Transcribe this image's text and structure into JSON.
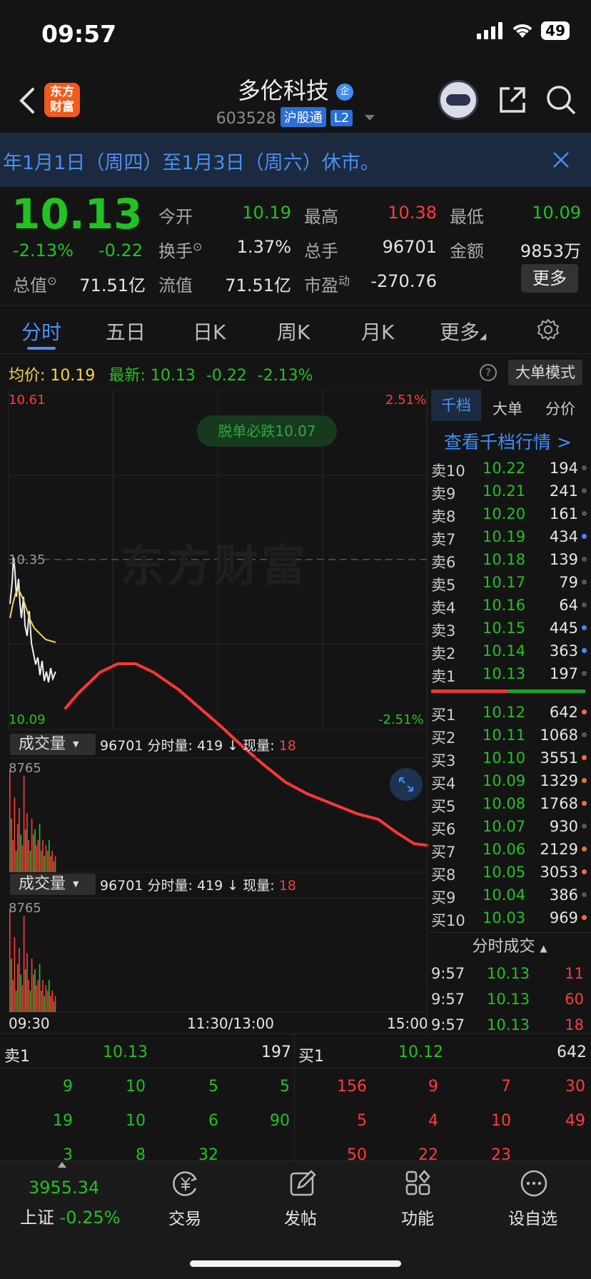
{
  "status": {
    "time": "09:57",
    "battery": "49"
  },
  "header": {
    "back_icon": "chevron-left-icon",
    "logo_text": "东方财富",
    "title": "多伦科技",
    "title_badge": "企",
    "code": "603528",
    "tag1": "沪股通",
    "tag2": "L2"
  },
  "notice": {
    "text": "年1月1日（周四）至1月3日（周六）休市。"
  },
  "quote": {
    "price": "10.13",
    "pct": "-2.13%",
    "change": "-0.22",
    "open_label": "今开",
    "open": "10.19",
    "high_label": "最高",
    "high": "10.38",
    "low_label": "最低",
    "low": "10.09",
    "turnover_label": "换手",
    "turnover": "1.37%",
    "vol_label": "总手",
    "vol": "96701",
    "amount_label": "金额",
    "amount": "9853万",
    "mktcap_label": "总值",
    "mktcap": "71.51亿",
    "float_label": "流值",
    "float": "71.51亿",
    "pe_label": "市盈",
    "pe_sup": "动",
    "pe": "-270.76",
    "more_label": "更多"
  },
  "tabs": [
    "分时",
    "五日",
    "日K",
    "周K",
    "月K",
    "更多"
  ],
  "avg_bar": {
    "avg_label": "均价:",
    "avg": "10.19",
    "latest_label": "最新:",
    "latest": "10.13",
    "change": "-0.22",
    "pct": "-2.13%",
    "mode_label": "大单模式"
  },
  "chart": {
    "top_price": "10.61",
    "top_pct": "2.51%",
    "mid_price": "10.35",
    "bottom_price": "10.09",
    "bottom_pct": "-2.51%",
    "watermark": "东方财富",
    "alert": "脱单必跌10.07",
    "vol_label": "成交量",
    "vol_total": "96701",
    "vol_minute_label": "分时量:",
    "vol_minute": "419",
    "vol_now_label": "现量:",
    "vol_now": "18",
    "vol_max": "8765",
    "time_start": "09:30",
    "time_mid": "11:30/13:00",
    "time_end": "15:00"
  },
  "orderbook": {
    "tabs": [
      "千档",
      "大单",
      "分价"
    ],
    "link": "查看千档行情 >",
    "asks": [
      {
        "label": "卖10",
        "price": "10.22",
        "vol": "194"
      },
      {
        "label": "卖9",
        "price": "10.21",
        "vol": "241"
      },
      {
        "label": "卖8",
        "price": "10.20",
        "vol": "161"
      },
      {
        "label": "卖7",
        "price": "10.19",
        "vol": "434"
      },
      {
        "label": "卖6",
        "price": "10.18",
        "vol": "139"
      },
      {
        "label": "卖5",
        "price": "10.17",
        "vol": "79"
      },
      {
        "label": "卖4",
        "price": "10.16",
        "vol": "64"
      },
      {
        "label": "卖3",
        "price": "10.15",
        "vol": "445"
      },
      {
        "label": "卖2",
        "price": "10.14",
        "vol": "363"
      },
      {
        "label": "卖1",
        "price": "10.13",
        "vol": "197"
      }
    ],
    "bids": [
      {
        "label": "买1",
        "price": "10.12",
        "vol": "642"
      },
      {
        "label": "买2",
        "price": "10.11",
        "vol": "1068"
      },
      {
        "label": "买3",
        "price": "10.10",
        "vol": "3551"
      },
      {
        "label": "买4",
        "price": "10.09",
        "vol": "1329"
      },
      {
        "label": "买5",
        "price": "10.08",
        "vol": "1768"
      },
      {
        "label": "买6",
        "price": "10.07",
        "vol": "930"
      },
      {
        "label": "买7",
        "price": "10.06",
        "vol": "2129"
      },
      {
        "label": "买8",
        "price": "10.05",
        "vol": "3053"
      },
      {
        "label": "买9",
        "price": "10.04",
        "vol": "386"
      },
      {
        "label": "买10",
        "price": "10.03",
        "vol": "969"
      }
    ],
    "trades_title": "分时成交",
    "trades": [
      {
        "time": "9:57",
        "price": "10.13",
        "vol": "11"
      },
      {
        "time": "9:57",
        "price": "10.13",
        "vol": "60"
      },
      {
        "time": "9:57",
        "price": "10.13",
        "vol": "18"
      }
    ]
  },
  "level1": {
    "ask_label": "卖1",
    "ask_price": "10.13",
    "ask_vol": "197",
    "bid_label": "买1",
    "bid_price": "10.12",
    "bid_vol": "642",
    "ask_rows": [
      [
        "9",
        "10",
        "5",
        "5"
      ],
      [
        "19",
        "10",
        "6",
        "90"
      ],
      [
        "3",
        "8",
        "32",
        ""
      ]
    ],
    "bid_rows": [
      [
        "156",
        "9",
        "7",
        "30"
      ],
      [
        "5",
        "4",
        "10",
        "49"
      ],
      [
        "50",
        "22",
        "23",
        ""
      ]
    ]
  },
  "bottom_nav": {
    "index_value": "3955.34",
    "index_name": "上证",
    "index_pct": "-0.25%",
    "items": [
      "交易",
      "发帖",
      "功能",
      "设自选"
    ]
  },
  "colors": {
    "up": "#ff3b3b",
    "down": "#21c221",
    "accent": "#3e8ef7",
    "avg_line": "#f2d44a"
  }
}
